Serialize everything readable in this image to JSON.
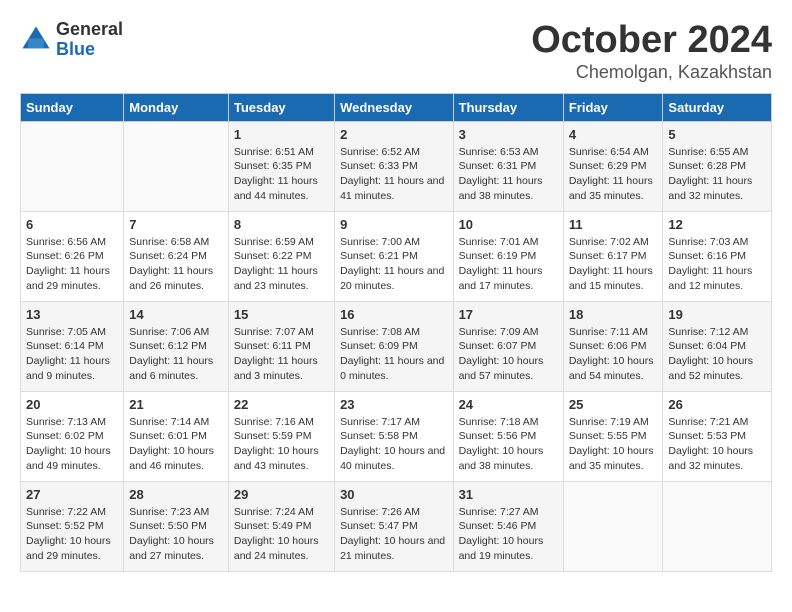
{
  "header": {
    "logo_general": "General",
    "logo_blue": "Blue",
    "month": "October 2024",
    "location": "Chemolgan, Kazakhstan"
  },
  "days_of_week": [
    "Sunday",
    "Monday",
    "Tuesday",
    "Wednesday",
    "Thursday",
    "Friday",
    "Saturday"
  ],
  "weeks": [
    [
      {
        "day": "",
        "sunrise": "",
        "sunset": "",
        "daylight": ""
      },
      {
        "day": "",
        "sunrise": "",
        "sunset": "",
        "daylight": ""
      },
      {
        "day": "1",
        "sunrise": "Sunrise: 6:51 AM",
        "sunset": "Sunset: 6:35 PM",
        "daylight": "Daylight: 11 hours and 44 minutes."
      },
      {
        "day": "2",
        "sunrise": "Sunrise: 6:52 AM",
        "sunset": "Sunset: 6:33 PM",
        "daylight": "Daylight: 11 hours and 41 minutes."
      },
      {
        "day": "3",
        "sunrise": "Sunrise: 6:53 AM",
        "sunset": "Sunset: 6:31 PM",
        "daylight": "Daylight: 11 hours and 38 minutes."
      },
      {
        "day": "4",
        "sunrise": "Sunrise: 6:54 AM",
        "sunset": "Sunset: 6:29 PM",
        "daylight": "Daylight: 11 hours and 35 minutes."
      },
      {
        "day": "5",
        "sunrise": "Sunrise: 6:55 AM",
        "sunset": "Sunset: 6:28 PM",
        "daylight": "Daylight: 11 hours and 32 minutes."
      }
    ],
    [
      {
        "day": "6",
        "sunrise": "Sunrise: 6:56 AM",
        "sunset": "Sunset: 6:26 PM",
        "daylight": "Daylight: 11 hours and 29 minutes."
      },
      {
        "day": "7",
        "sunrise": "Sunrise: 6:58 AM",
        "sunset": "Sunset: 6:24 PM",
        "daylight": "Daylight: 11 hours and 26 minutes."
      },
      {
        "day": "8",
        "sunrise": "Sunrise: 6:59 AM",
        "sunset": "Sunset: 6:22 PM",
        "daylight": "Daylight: 11 hours and 23 minutes."
      },
      {
        "day": "9",
        "sunrise": "Sunrise: 7:00 AM",
        "sunset": "Sunset: 6:21 PM",
        "daylight": "Daylight: 11 hours and 20 minutes."
      },
      {
        "day": "10",
        "sunrise": "Sunrise: 7:01 AM",
        "sunset": "Sunset: 6:19 PM",
        "daylight": "Daylight: 11 hours and 17 minutes."
      },
      {
        "day": "11",
        "sunrise": "Sunrise: 7:02 AM",
        "sunset": "Sunset: 6:17 PM",
        "daylight": "Daylight: 11 hours and 15 minutes."
      },
      {
        "day": "12",
        "sunrise": "Sunrise: 7:03 AM",
        "sunset": "Sunset: 6:16 PM",
        "daylight": "Daylight: 11 hours and 12 minutes."
      }
    ],
    [
      {
        "day": "13",
        "sunrise": "Sunrise: 7:05 AM",
        "sunset": "Sunset: 6:14 PM",
        "daylight": "Daylight: 11 hours and 9 minutes."
      },
      {
        "day": "14",
        "sunrise": "Sunrise: 7:06 AM",
        "sunset": "Sunset: 6:12 PM",
        "daylight": "Daylight: 11 hours and 6 minutes."
      },
      {
        "day": "15",
        "sunrise": "Sunrise: 7:07 AM",
        "sunset": "Sunset: 6:11 PM",
        "daylight": "Daylight: 11 hours and 3 minutes."
      },
      {
        "day": "16",
        "sunrise": "Sunrise: 7:08 AM",
        "sunset": "Sunset: 6:09 PM",
        "daylight": "Daylight: 11 hours and 0 minutes."
      },
      {
        "day": "17",
        "sunrise": "Sunrise: 7:09 AM",
        "sunset": "Sunset: 6:07 PM",
        "daylight": "Daylight: 10 hours and 57 minutes."
      },
      {
        "day": "18",
        "sunrise": "Sunrise: 7:11 AM",
        "sunset": "Sunset: 6:06 PM",
        "daylight": "Daylight: 10 hours and 54 minutes."
      },
      {
        "day": "19",
        "sunrise": "Sunrise: 7:12 AM",
        "sunset": "Sunset: 6:04 PM",
        "daylight": "Daylight: 10 hours and 52 minutes."
      }
    ],
    [
      {
        "day": "20",
        "sunrise": "Sunrise: 7:13 AM",
        "sunset": "Sunset: 6:02 PM",
        "daylight": "Daylight: 10 hours and 49 minutes."
      },
      {
        "day": "21",
        "sunrise": "Sunrise: 7:14 AM",
        "sunset": "Sunset: 6:01 PM",
        "daylight": "Daylight: 10 hours and 46 minutes."
      },
      {
        "day": "22",
        "sunrise": "Sunrise: 7:16 AM",
        "sunset": "Sunset: 5:59 PM",
        "daylight": "Daylight: 10 hours and 43 minutes."
      },
      {
        "day": "23",
        "sunrise": "Sunrise: 7:17 AM",
        "sunset": "Sunset: 5:58 PM",
        "daylight": "Daylight: 10 hours and 40 minutes."
      },
      {
        "day": "24",
        "sunrise": "Sunrise: 7:18 AM",
        "sunset": "Sunset: 5:56 PM",
        "daylight": "Daylight: 10 hours and 38 minutes."
      },
      {
        "day": "25",
        "sunrise": "Sunrise: 7:19 AM",
        "sunset": "Sunset: 5:55 PM",
        "daylight": "Daylight: 10 hours and 35 minutes."
      },
      {
        "day": "26",
        "sunrise": "Sunrise: 7:21 AM",
        "sunset": "Sunset: 5:53 PM",
        "daylight": "Daylight: 10 hours and 32 minutes."
      }
    ],
    [
      {
        "day": "27",
        "sunrise": "Sunrise: 7:22 AM",
        "sunset": "Sunset: 5:52 PM",
        "daylight": "Daylight: 10 hours and 29 minutes."
      },
      {
        "day": "28",
        "sunrise": "Sunrise: 7:23 AM",
        "sunset": "Sunset: 5:50 PM",
        "daylight": "Daylight: 10 hours and 27 minutes."
      },
      {
        "day": "29",
        "sunrise": "Sunrise: 7:24 AM",
        "sunset": "Sunset: 5:49 PM",
        "daylight": "Daylight: 10 hours and 24 minutes."
      },
      {
        "day": "30",
        "sunrise": "Sunrise: 7:26 AM",
        "sunset": "Sunset: 5:47 PM",
        "daylight": "Daylight: 10 hours and 21 minutes."
      },
      {
        "day": "31",
        "sunrise": "Sunrise: 7:27 AM",
        "sunset": "Sunset: 5:46 PM",
        "daylight": "Daylight: 10 hours and 19 minutes."
      },
      {
        "day": "",
        "sunrise": "",
        "sunset": "",
        "daylight": ""
      },
      {
        "day": "",
        "sunrise": "",
        "sunset": "",
        "daylight": ""
      }
    ]
  ]
}
